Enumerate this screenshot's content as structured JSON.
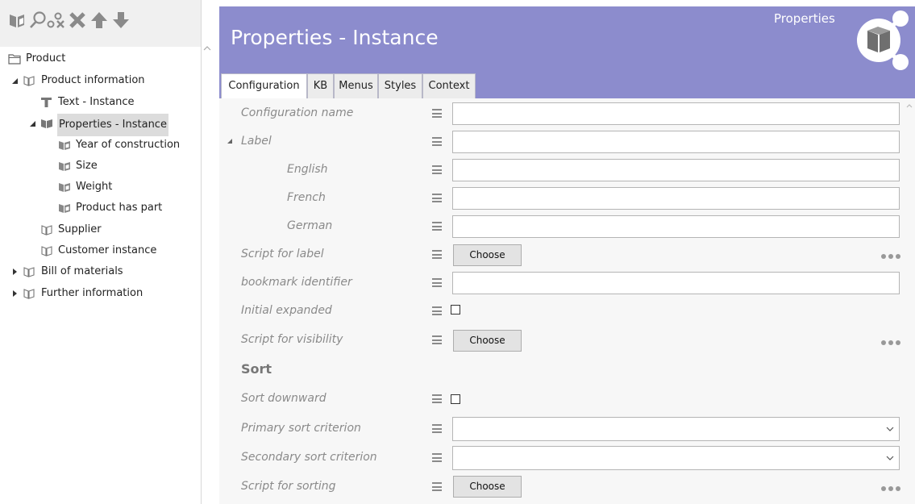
{
  "toolbar": {
    "icons": [
      "add-instance-icon",
      "search-icon",
      "link-icon",
      "delete-icon",
      "move-up-icon",
      "move-down-icon"
    ]
  },
  "tree": {
    "root": "Product",
    "items": [
      {
        "label": "Product information",
        "icon": "folder-icon",
        "expanded": true
      },
      {
        "label": "Text - Instance",
        "icon": "text-icon"
      },
      {
        "label": "Properties - Instance",
        "icon": "properties-icon",
        "expanded": true,
        "selected": true
      },
      {
        "label": "Year of construction",
        "icon": "property-icon"
      },
      {
        "label": "Size",
        "icon": "property-icon"
      },
      {
        "label": "Weight",
        "icon": "property-icon"
      },
      {
        "label": "Product has part",
        "icon": "property-icon"
      },
      {
        "label": "Supplier",
        "icon": "folder-icon"
      },
      {
        "label": "Customer instance",
        "icon": "folder-icon"
      },
      {
        "label": "Bill of materials",
        "icon": "folder-icon",
        "expanded": false
      },
      {
        "label": "Further information",
        "icon": "folder-icon",
        "expanded": false
      }
    ]
  },
  "header": {
    "title": "Properties - Instance",
    "type_label": "Properties",
    "color": "#8c8ccd"
  },
  "tabs": [
    {
      "label": "Configuration",
      "active": true
    },
    {
      "label": "KB"
    },
    {
      "label": "Menus"
    },
    {
      "label": "Styles"
    },
    {
      "label": "Context"
    }
  ],
  "form": {
    "configuration_name": {
      "label": "Configuration name",
      "value": ""
    },
    "label": {
      "label": "Label",
      "value": ""
    },
    "english": {
      "label": "English",
      "value": ""
    },
    "french": {
      "label": "French",
      "value": ""
    },
    "german": {
      "label": "German",
      "value": ""
    },
    "script_for_label": {
      "label": "Script for label",
      "button": "Choose"
    },
    "bookmark_identifier": {
      "label": "bookmark identifier",
      "value": ""
    },
    "initial_expanded": {
      "label": "Initial expanded",
      "checked": false
    },
    "script_for_visibility": {
      "label": "Script for visibility",
      "button": "Choose"
    },
    "sort_heading": "Sort",
    "sort_downward": {
      "label": "Sort downward",
      "checked": false
    },
    "primary_sort_criterion": {
      "label": "Primary sort criterion",
      "value": ""
    },
    "secondary_sort_criterion": {
      "label": "Secondary sort criterion",
      "value": ""
    },
    "script_for_sorting": {
      "label": "Script for sorting",
      "button": "Choose"
    }
  }
}
